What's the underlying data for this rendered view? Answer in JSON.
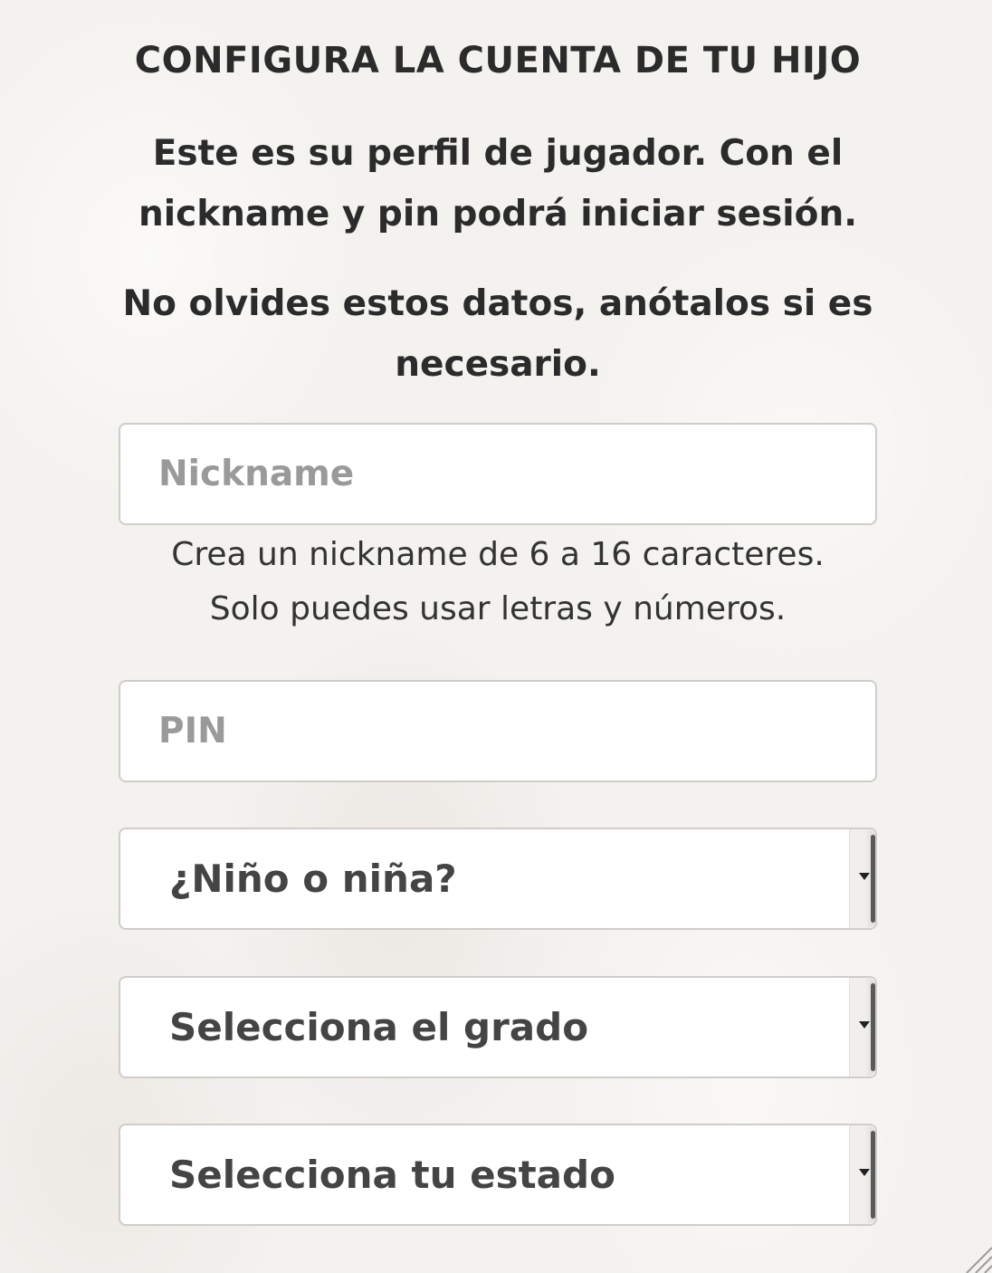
{
  "header": {
    "title": "CONFIGURA LA CUENTA DE TU HIJO",
    "intro_1": "Este es su perfil de jugador. Con el nickname y pin podrá iniciar sesión.",
    "intro_2": "No olvides estos datos, anótalos si es necesario."
  },
  "form": {
    "nickname": {
      "placeholder": "Nickname",
      "value": "",
      "helper_line_1": "Crea un nickname de 6 a 16 caracteres.",
      "helper_line_2": "Solo puedes usar letras y números."
    },
    "pin": {
      "placeholder": "PIN",
      "value": ""
    },
    "gender": {
      "selected": "¿Niño o niña?"
    },
    "grade": {
      "selected": "Selecciona el grado"
    },
    "state": {
      "selected": "Selecciona tu estado"
    }
  },
  "icons": {
    "dropdown": "chevron-down-icon",
    "resize": "resize-grip-icon"
  },
  "colors": {
    "background": "#f4f2ef",
    "text": "#2b2b2b",
    "placeholder": "#9a9a9a",
    "field_border": "#cfcdca"
  }
}
